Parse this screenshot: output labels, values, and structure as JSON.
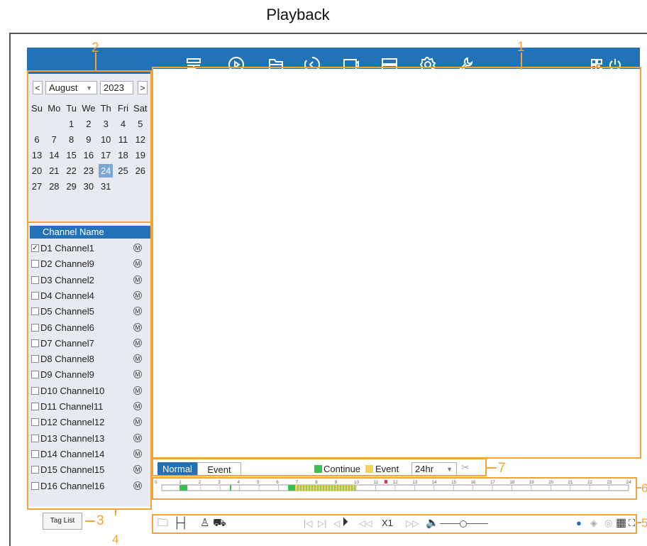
{
  "heading": "Playback",
  "nav": {
    "icons": [
      "live-view-icon",
      "playback-icon",
      "file-search-icon",
      "backup-icon",
      "camera-icon",
      "storage-icon",
      "settings-icon",
      "maintenance-icon"
    ],
    "right_icons": [
      "qr-code-icon",
      "power-icon"
    ]
  },
  "calendar": {
    "prev": "<",
    "next": ">",
    "month": "August",
    "year": "2023",
    "weekdays": [
      "Su",
      "Mo",
      "Tu",
      "We",
      "Th",
      "Fri",
      "Sat"
    ],
    "days": [
      "1",
      "2",
      "3",
      "4",
      "5",
      "6",
      "7",
      "8",
      "9",
      "10",
      "11",
      "12",
      "13",
      "14",
      "15",
      "16",
      "17",
      "18",
      "19",
      "20",
      "21",
      "22",
      "23",
      "24",
      "25",
      "26",
      "27",
      "28",
      "29",
      "30",
      "31"
    ],
    "selected_day": "24"
  },
  "channels": {
    "header": "Channel Name",
    "items": [
      {
        "name": "D1 Channel1",
        "checked": true,
        "badge": "M"
      },
      {
        "name": "D2 Channel9",
        "checked": false,
        "badge": "M"
      },
      {
        "name": "D3 Channel2",
        "checked": false,
        "badge": "M"
      },
      {
        "name": "D4 Channel4",
        "checked": false,
        "badge": "M"
      },
      {
        "name": "D5 Channel5",
        "checked": false,
        "badge": "M"
      },
      {
        "name": "D6 Channel6",
        "checked": false,
        "badge": "M"
      },
      {
        "name": "D7 Channel7",
        "checked": false,
        "badge": "M"
      },
      {
        "name": "D8 Channel8",
        "checked": false,
        "badge": "M"
      },
      {
        "name": "D9 Channel9",
        "checked": false,
        "badge": "M"
      },
      {
        "name": "D10 Channel10",
        "checked": false,
        "badge": "M"
      },
      {
        "name": "D11 Channel11",
        "checked": false,
        "badge": "M"
      },
      {
        "name": "D12 Channel12",
        "checked": false,
        "badge": "M"
      },
      {
        "name": "D13 Channel13",
        "checked": false,
        "badge": "M"
      },
      {
        "name": "D14 Channel14",
        "checked": false,
        "badge": "M"
      },
      {
        "name": "D15 Channel15",
        "checked": false,
        "badge": "M"
      },
      {
        "name": "D16 Channel16",
        "checked": false,
        "badge": "M"
      }
    ]
  },
  "mode": {
    "normal": "Normal",
    "event": "Event",
    "legend_continue": "Continue",
    "legend_event": "Event",
    "range": "24hr",
    "colors": {
      "continue": "#3bbf54",
      "event": "#f1d35a",
      "accent": "#2371b6",
      "callout": "#f3a33a"
    }
  },
  "timeline": {
    "hours": [
      "0",
      "1",
      "2",
      "3",
      "4",
      "5",
      "6",
      "7",
      "8",
      "9",
      "10",
      "11",
      "12",
      "13",
      "14",
      "15",
      "16",
      "17",
      "18",
      "19",
      "20",
      "21",
      "22",
      "23",
      "24"
    ]
  },
  "controls": {
    "speed": "X1",
    "tag_list": "Tag List"
  },
  "callouts": [
    "1",
    "2",
    "3",
    "4",
    "5",
    "6",
    "7"
  ]
}
